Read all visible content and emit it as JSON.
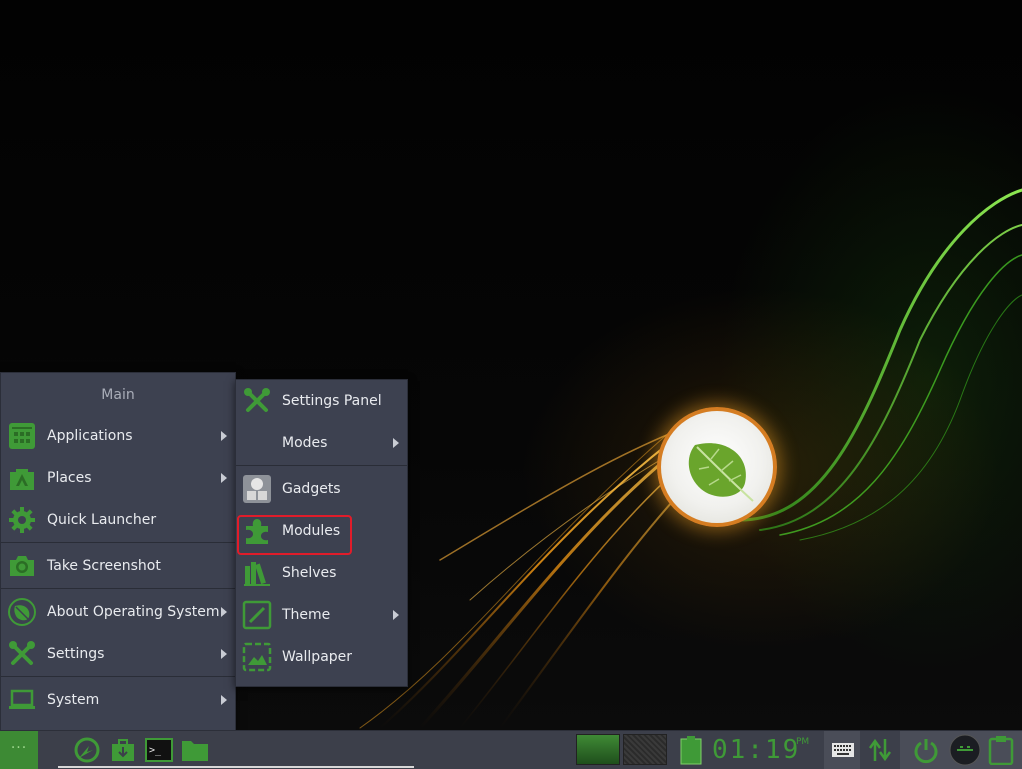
{
  "main_menu": {
    "title": "Main",
    "items": [
      {
        "label": "Applications",
        "icon": "applications-grid-icon",
        "has_submenu": true
      },
      {
        "label": "Places",
        "icon": "places-icon",
        "has_submenu": true
      },
      {
        "label": "Quick Launcher",
        "icon": "gear-icon",
        "has_submenu": false
      },
      {
        "label": "Take Screenshot",
        "icon": "camera-icon",
        "has_submenu": false
      },
      {
        "label": "About Operating System",
        "icon": "leaf-icon",
        "has_submenu": true
      },
      {
        "label": "Settings",
        "icon": "tools-icon",
        "has_submenu": true
      },
      {
        "label": "System",
        "icon": "laptop-icon",
        "has_submenu": true
      }
    ]
  },
  "settings_submenu": {
    "items": [
      {
        "label": "Settings Panel",
        "icon": "tools-icon",
        "has_submenu": false
      },
      {
        "label": "Modes",
        "icon": "",
        "has_submenu": true
      },
      {
        "label": "Gadgets",
        "icon": "gadgets-icon",
        "has_submenu": false
      },
      {
        "label": "Modules",
        "icon": "puzzle-icon",
        "has_submenu": false,
        "highlighted": true
      },
      {
        "label": "Shelves",
        "icon": "books-icon",
        "has_submenu": false
      },
      {
        "label": "Theme",
        "icon": "brush-icon",
        "has_submenu": true
      },
      {
        "label": "Wallpaper",
        "icon": "picture-icon",
        "has_submenu": false
      }
    ]
  },
  "taskbar": {
    "start_label": "···",
    "launchers": [
      "app-launcher-icon",
      "package-icon",
      "terminal-icon",
      "folder-icon"
    ],
    "clock": "01:19",
    "clock_ampm": "PM"
  },
  "colors": {
    "accent_green": "#3f9a37",
    "menu_bg": "#3d4150",
    "highlight_red": "#e11c2a",
    "logo_ring": "#d57d22"
  }
}
